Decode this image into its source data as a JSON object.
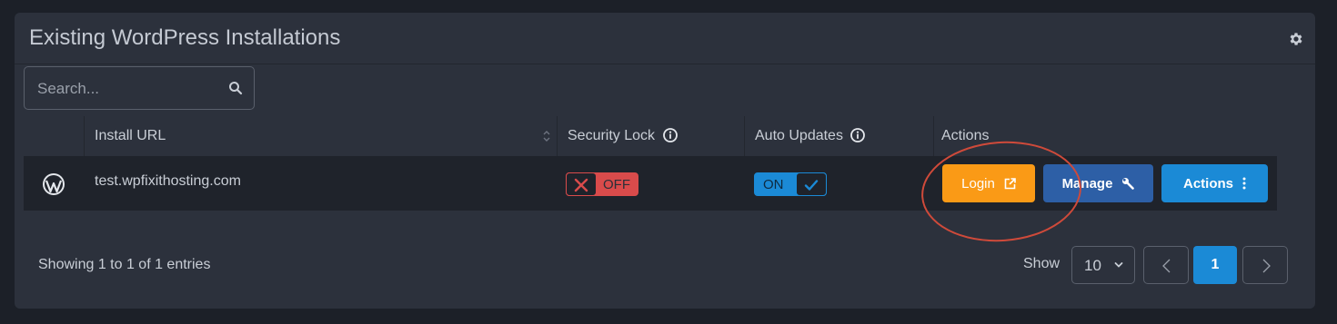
{
  "panel": {
    "title": "Existing WordPress Installations",
    "settings_icon": "gear-icon"
  },
  "search": {
    "placeholder": "Search...",
    "icon": "search-icon"
  },
  "table": {
    "columns": [
      "Install URL",
      "Security Lock",
      "Auto Updates",
      "Actions"
    ],
    "rows": [
      {
        "icon": "wordpress-icon",
        "url": "test.wpfixithosting.com",
        "security_lock": "OFF",
        "auto_updates": "ON",
        "buttons": {
          "login": "Login",
          "manage": "Manage",
          "actions": "Actions"
        }
      }
    ]
  },
  "footer": {
    "entries_info": "Showing 1 to 1 of 1 entries",
    "show_label": "Show",
    "page_length": "10",
    "current_page": "1"
  },
  "colors": {
    "panel_bg": "#2c313c",
    "row_bg": "#1f232b",
    "lock_off": "#d94b4b",
    "updates_on": "#1b8ad6",
    "login_btn": "#fa9a16",
    "manage_btn": "#2d5fa6",
    "actions_btn": "#1b8ad6",
    "annotation": "#cf4a3a"
  }
}
